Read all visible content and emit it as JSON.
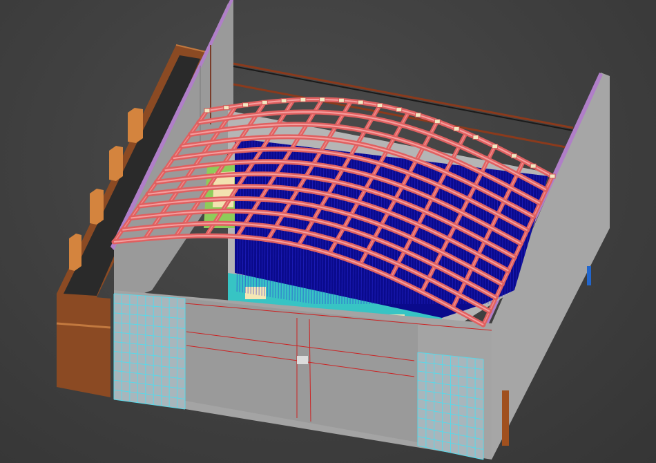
{
  "app": {
    "type": "3d-viewport",
    "view": "perspective"
  },
  "scene": {
    "background_color": "#3e3e3e",
    "objects": [
      {
        "name": "orange-side-annex",
        "color": "#8b4a23"
      },
      {
        "name": "grey-wall-left",
        "color": "#9a9a9a"
      },
      {
        "name": "grey-wall-right",
        "color": "#a6a6a6"
      },
      {
        "name": "front-facade",
        "color": "#a4a4a4"
      },
      {
        "name": "glass-curtain-left",
        "color": "#a8c4d0"
      },
      {
        "name": "glass-curtain-right",
        "color": "#a8c4d0"
      },
      {
        "name": "interior-seating",
        "color": "#0a0a8c"
      },
      {
        "name": "roof-truss-grid",
        "color": "#e06060"
      },
      {
        "name": "floor-teal",
        "color": "#37c4c4"
      },
      {
        "name": "blue-post",
        "color": "#2266cc"
      },
      {
        "name": "orange-post",
        "color": "#a0501e"
      }
    ]
  }
}
